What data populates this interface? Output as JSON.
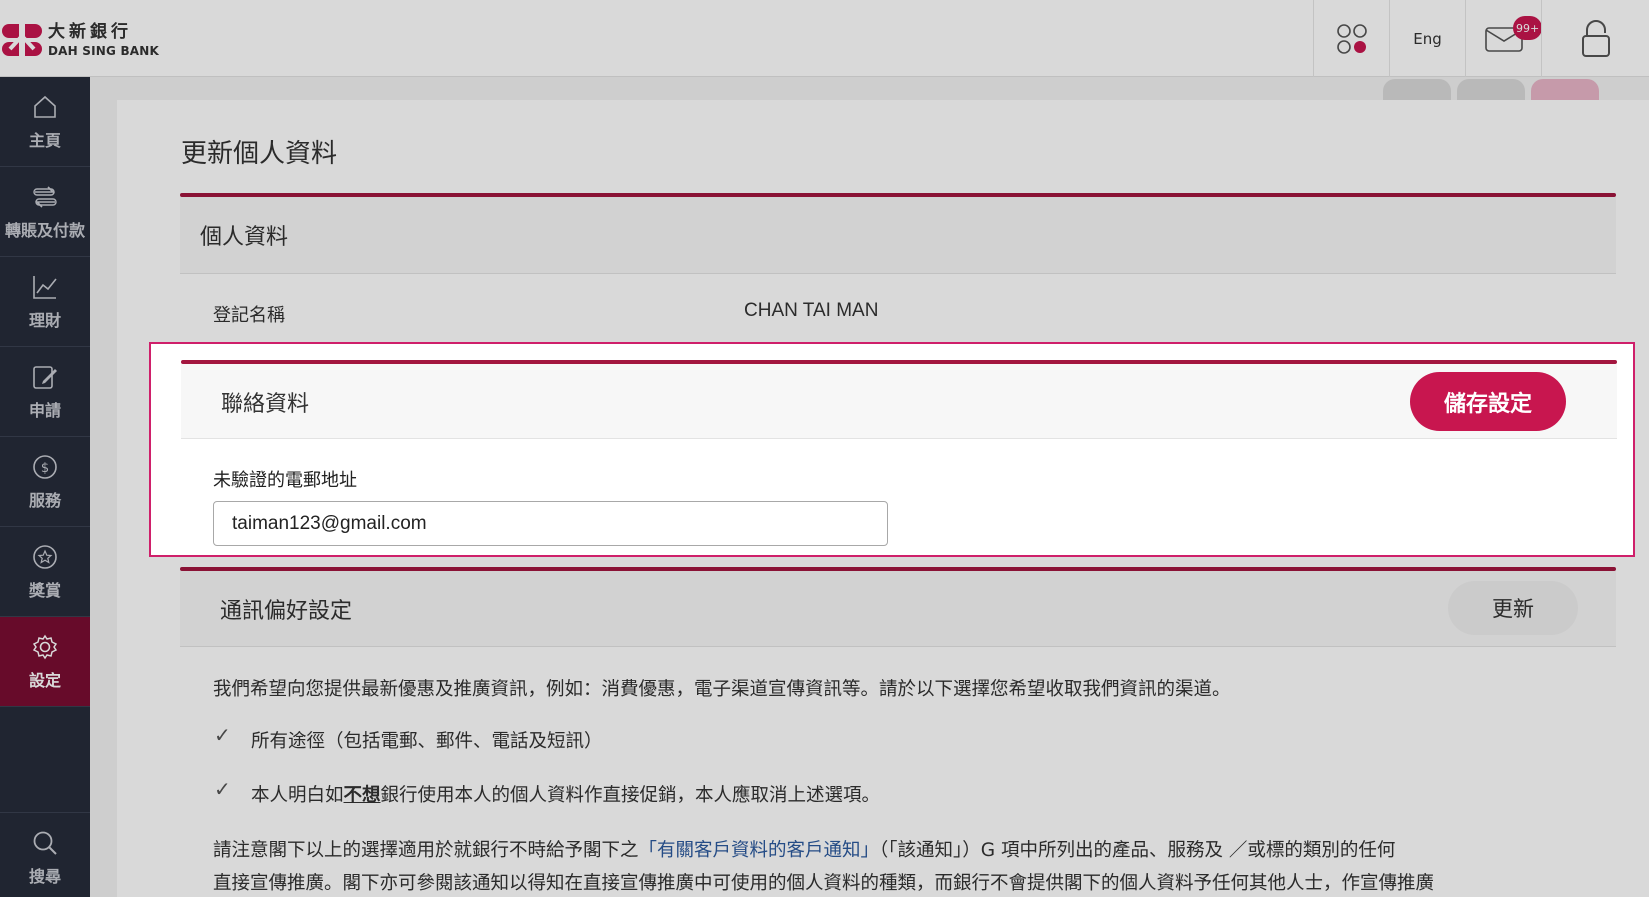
{
  "header": {
    "logo_cn": "大新銀行",
    "logo_en": "DAH SING BANK",
    "lang": "Eng",
    "inbox_badge": "99+",
    "icons": [
      "apps-icon",
      "mail-icon",
      "lock-icon"
    ]
  },
  "sidebar": {
    "items": [
      {
        "label": "主頁",
        "icon": "home-icon"
      },
      {
        "label": "轉賬及付款",
        "icon": "transfer-icon"
      },
      {
        "label": "理財",
        "icon": "chart-icon"
      },
      {
        "label": "申請",
        "icon": "edit-icon"
      },
      {
        "label": "服務",
        "icon": "dollar-icon"
      },
      {
        "label": "獎賞",
        "icon": "star-icon"
      },
      {
        "label": "設定",
        "icon": "gear-icon",
        "active": true
      },
      {
        "label": "搜尋",
        "icon": "search-icon"
      }
    ]
  },
  "page": {
    "title": "更新個人資料",
    "personal": {
      "title": "個人資料",
      "name_label": "登記名稱",
      "name_value": "CHAN TAI MAN"
    },
    "contact": {
      "title": "聯絡資料",
      "save_label": "儲存設定",
      "email_label": "未驗證的電郵地址",
      "email_value": "taiman123@gmail.com"
    },
    "comm": {
      "title": "通訊偏好設定",
      "update_label": "更新",
      "intro": "我們希望向您提供最新優惠及推廣資訊，例如：消費優惠，電子渠道宣傳資訊等。請於以下選擇您希望收取我們資訊的渠道。",
      "option1": "所有途徑（包括電郵、郵件、電話及短訊）",
      "option2_pre": "本人明白如",
      "option2_u": "不想",
      "option2_post": "銀行使用本人的個人資料作直接促銷，本人應取消上述選項。",
      "note_pre": "請注意閣下以上的選擇適用於就銀行不時給予閣下之",
      "note_link": "「有關客戶資料的客戶通知」",
      "note_post": "（「該通知」）G 項中所列出的產品、服務及 ／或標的類別的任何",
      "note_line2": "直接宣傳推廣。閣下亦可參閱該通知以得知在直接宣傳推廣中可使用的個人資料的種類，而銀行不會提供閣下的個人資料予任何其他人士，作宣傳推廣"
    }
  },
  "colors": {
    "brand": "#c8164f",
    "sidebar": "#262c3a",
    "active": "#7a0d32",
    "highlight": "#cf1f6a"
  }
}
